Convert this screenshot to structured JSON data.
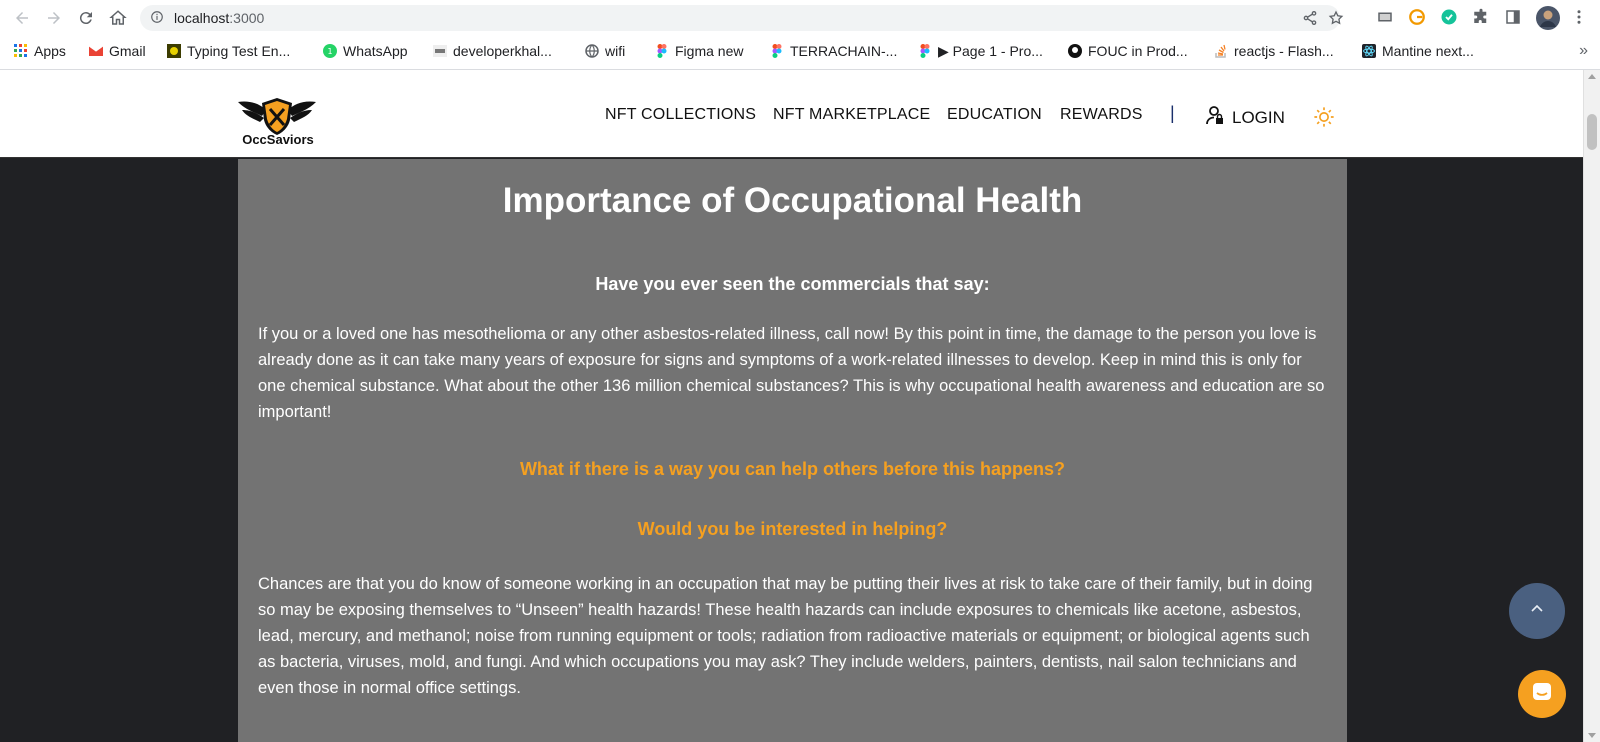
{
  "browser": {
    "url_host": "localhost",
    "url_port": ":3000",
    "bookmarks": [
      {
        "label": "Apps",
        "icon": "apps-grid-icon"
      },
      {
        "label": "Gmail",
        "icon": "gmail-icon"
      },
      {
        "label": "Typing Test En...",
        "icon": "typing-test-icon"
      },
      {
        "label": "WhatsApp",
        "icon": "whatsapp-icon"
      },
      {
        "label": "developerkhal...",
        "icon": "dev-icon"
      },
      {
        "label": "wifi",
        "icon": "globe-icon"
      },
      {
        "label": "Figma new",
        "icon": "figma-icon"
      },
      {
        "label": "TERRACHAIN-...",
        "icon": "figma-icon"
      },
      {
        "label": "▶ Page 1 - Pro...",
        "icon": "figma-icon"
      },
      {
        "label": "FOUC in Prod...",
        "icon": "github-icon"
      },
      {
        "label": "reactjs - Flash...",
        "icon": "stackoverflow-icon"
      },
      {
        "label": "Mantine next...",
        "icon": "react-icon"
      }
    ],
    "more_label": "»"
  },
  "site": {
    "logo_text": "OccSaviors",
    "nav": {
      "nft_collections": "NFT COLLECTIONS",
      "nft_marketplace": "NFT MARKETPLACE",
      "education": "EDUCATION",
      "rewards": "REWARDS",
      "separator": "|",
      "login": "LOGIN"
    },
    "accent_color": "#f5a020",
    "card_color": "#737373"
  },
  "content": {
    "title": "Importance of Occupational Health",
    "question_commercials": "Have you ever seen the commercials that say:",
    "paragraph_1": "If you or a loved one has mesothelioma or any other asbestos-related illness, call now! By this point in time, the damage to the person you love is already done as it can take many years of exposure for signs and symptoms of a work-related illnesses to develop. Keep in mind this is only for one chemical substance. What about the other 136 million chemical substances? This is why occupational health awareness and education are so important!",
    "question_help_others": "What if there is a way you can help others before this happens?",
    "question_interested": "Would you be interested in helping?",
    "paragraph_2": "Chances are that you do know of someone working in an occupation that may be putting their lives at risk to take care of their family, but in doing so may be exposing themselves to “Unseen” health hazards! These health hazards can include exposures to chemicals like acetone, asbestos, lead, mercury, and methanol; noise from running equipment or tools; radiation from radioactive materials or equipment; or biological agents such as bacteria, viruses, mold, and fungi. And which occupations you may ask? They include welders, painters, dentists, nail salon technicians and even those in normal office settings."
  }
}
